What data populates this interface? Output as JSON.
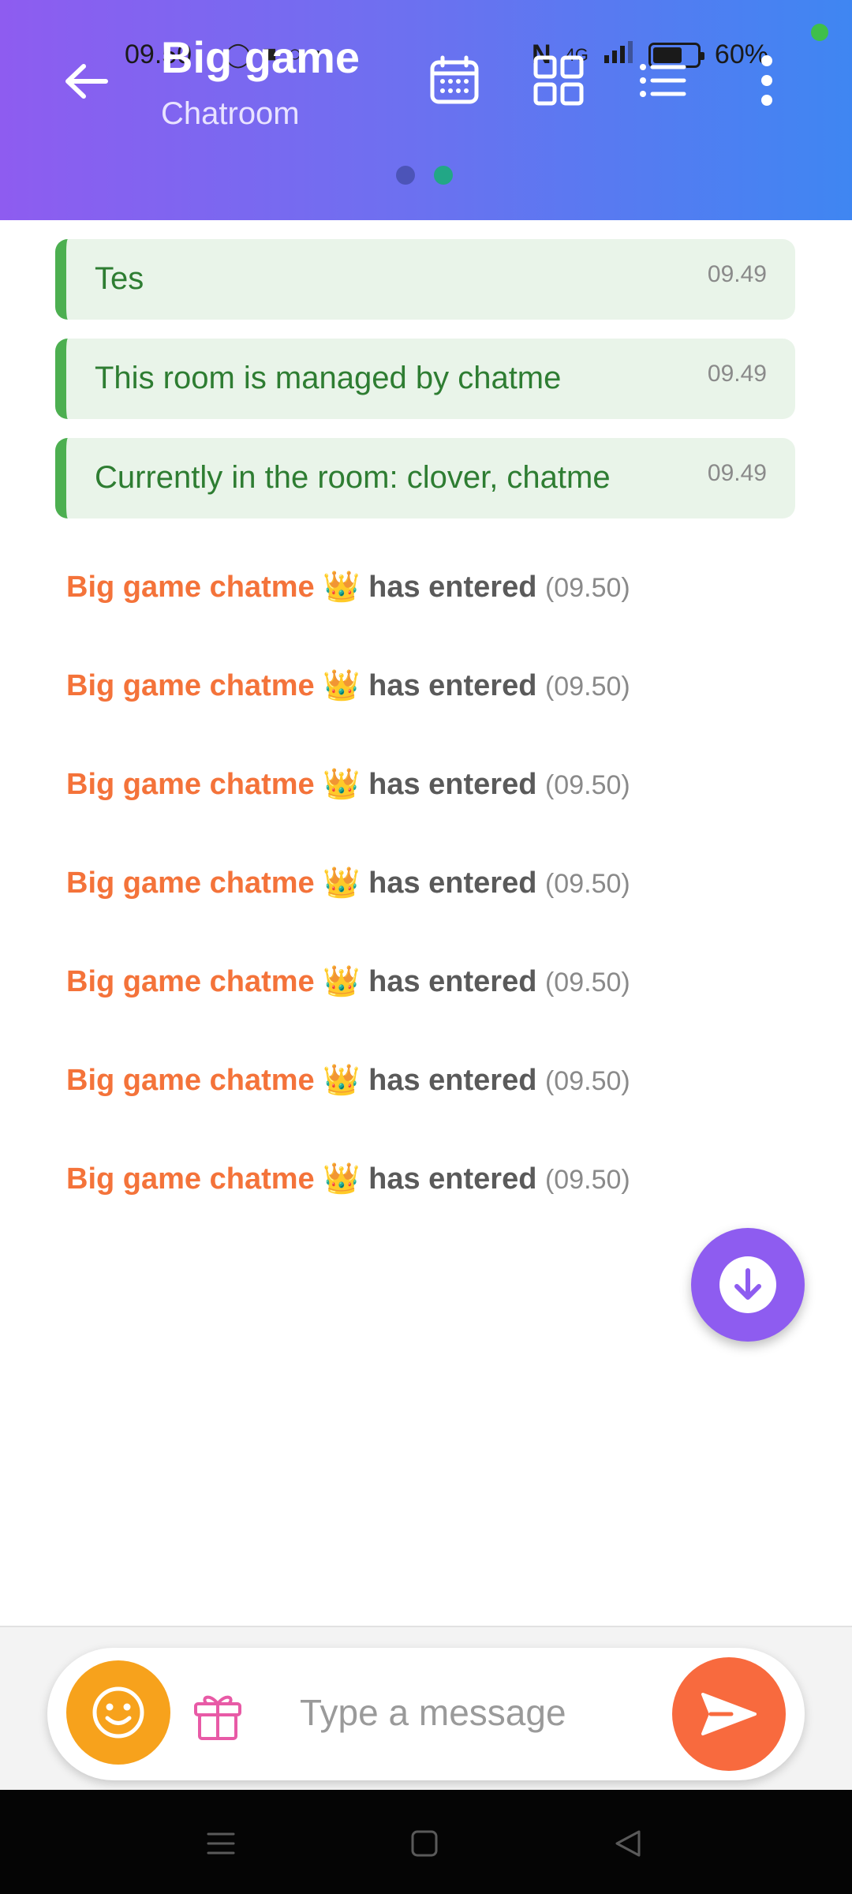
{
  "status_bar": {
    "time": "09.50",
    "battery": "60%",
    "network": "4G",
    "battery_level": 0.6
  },
  "header": {
    "title": "Big game",
    "subtitle": "Chatroom",
    "page_count": 2,
    "active_page": 2,
    "colors": {
      "gradient_start": "#8e5cf0",
      "gradient_end": "#3f86f2"
    }
  },
  "system_messages": [
    {
      "text": "Tes",
      "time": "09.49"
    },
    {
      "text": "This room is managed by chatme",
      "time": "09.49"
    },
    {
      "text": "Currently in the room: clover, chatme",
      "time": "09.49"
    }
  ],
  "join_events": [
    {
      "name": "Big game chatme",
      "badge": "👑",
      "action": "has entered",
      "time": "(09.50)"
    },
    {
      "name": "Big game chatme",
      "badge": "👑",
      "action": "has entered",
      "time": "(09.50)"
    },
    {
      "name": "Big game chatme",
      "badge": "👑",
      "action": "has entered",
      "time": "(09.50)"
    },
    {
      "name": "Big game chatme",
      "badge": "👑",
      "action": "has entered",
      "time": "(09.50)"
    },
    {
      "name": "Big game chatme",
      "badge": "👑",
      "action": "has entered",
      "time": "(09.50)"
    },
    {
      "name": "Big game chatme",
      "badge": "👑",
      "action": "has entered",
      "time": "(09.50)"
    },
    {
      "name": "Big game chatme",
      "badge": "👑",
      "action": "has entered",
      "time": "(09.50)"
    }
  ],
  "composer": {
    "placeholder": "Type a message",
    "value": ""
  },
  "icons": {
    "back": "arrow-left-icon",
    "calendar": "calendar-icon",
    "grid": "grid-icon",
    "list": "list-icon",
    "more": "more-vertical-icon",
    "scroll_down": "arrow-down-circle-icon",
    "emoji": "smiley-icon",
    "gift": "gift-icon",
    "send": "send-icon"
  },
  "theme": {
    "accent": "#8e5cf0",
    "join_name_color": "#f4733a",
    "system_text_color": "#2e7d32",
    "send_color": "#f86a3e",
    "emoji_color": "#f7a21c"
  }
}
